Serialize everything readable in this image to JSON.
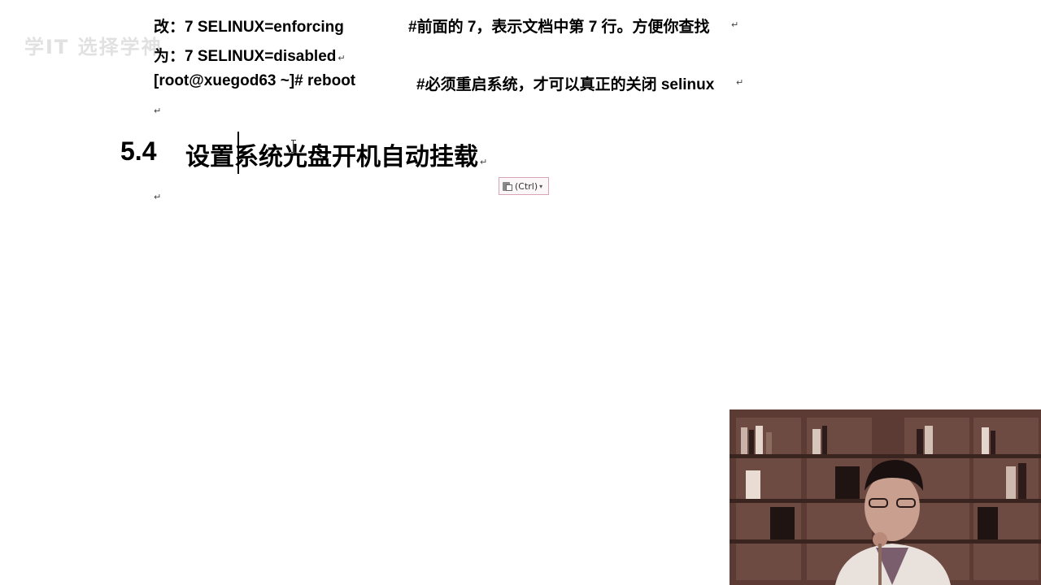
{
  "watermark": {
    "text": "学IT 选择学神"
  },
  "document": {
    "lines": [
      {
        "label": "改：",
        "cmd": "7 SELINUX=enforcing",
        "comment": "#前面的 7，表示文档中第 7 行。方便你查找"
      },
      {
        "label": "为：",
        "cmd": "7 SELINUX=disabled",
        "comment": ""
      },
      {
        "label": "",
        "cmd": "[root@xuegod63 ~]# reboot",
        "comment": "#必须重启系统，才可以真正的关闭 selinux"
      }
    ],
    "paragraph_mark": "↵",
    "heading": {
      "number": "5.4",
      "title": "设置系统光盘开机自动挂载"
    }
  },
  "paste_options": {
    "label": "(Ctrl)",
    "arrow": "▾"
  },
  "icons": {
    "paste": "clipboard-icon",
    "dropdown": "chevron-down-icon",
    "cursor": "text-cursor-icon"
  },
  "colors": {
    "text": "#000000",
    "paste_border": "#d9a3b8",
    "webcam_bg": "#4a2f2a"
  }
}
